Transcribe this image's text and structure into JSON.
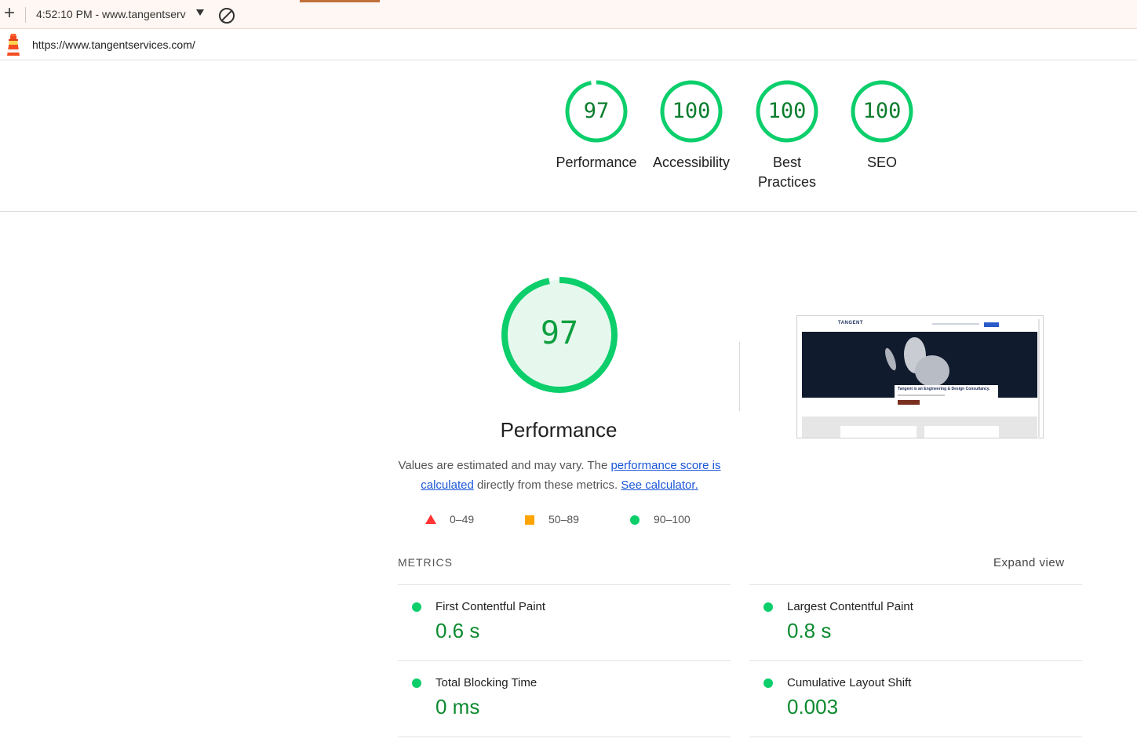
{
  "toolbar": {
    "new_report_label": "+",
    "report_title": "4:52:10 PM - www.tangentserv"
  },
  "urlbar": {
    "url": "https://www.tangentservices.com/"
  },
  "colors": {
    "pass": "#0cce6b",
    "pass_text": "#0c7d2e",
    "average": "#ffa400",
    "fail": "#ff3333",
    "link": "#1a56d8"
  },
  "gauges": [
    {
      "score": "97",
      "label": "Performance",
      "fraction": 0.97
    },
    {
      "score": "100",
      "label": "Accessibility",
      "fraction": 1.0
    },
    {
      "score": "100",
      "label": "Best Practices",
      "fraction": 1.0
    },
    {
      "score": "100",
      "label": "SEO",
      "fraction": 1.0
    }
  ],
  "performance": {
    "score": "97",
    "fraction": 0.97,
    "title": "Performance",
    "desc_prefix": "Values are estimated and may vary. The ",
    "desc_link1": "performance score is calculated",
    "desc_middle": " directly from these metrics. ",
    "desc_link2": "See calculator."
  },
  "legend": {
    "fail": "0–49",
    "average": "50–89",
    "pass": "90–100"
  },
  "thumbnail": {
    "brand": "TANGENT",
    "headline": "Tangent is an Engineering & Design Consultancy."
  },
  "metrics": {
    "header": "METRICS",
    "expand_label": "Expand view",
    "items": [
      {
        "label": "First Contentful Paint",
        "value": "0.6 s"
      },
      {
        "label": "Largest Contentful Paint",
        "value": "0.8 s"
      },
      {
        "label": "Total Blocking Time",
        "value": "0 ms"
      },
      {
        "label": "Cumulative Layout Shift",
        "value": "0.003"
      }
    ]
  }
}
